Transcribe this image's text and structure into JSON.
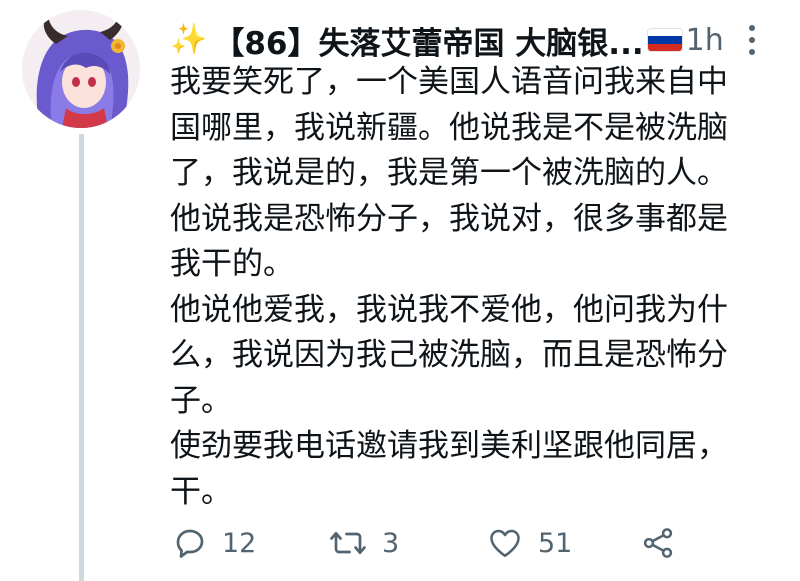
{
  "tweet": {
    "header": {
      "sparkle_icon": "sparkle-icon",
      "display_name": "【86】失落艾蕾帝国 大脑银...",
      "flag_icon": "russia-flag-icon",
      "flag_colors": [
        "#ffffff",
        "#0039a6",
        "#d52b1e"
      ],
      "time": "1h",
      "more_icon": "more-dots-icon"
    },
    "text_lines": [
      "我要笑死了，一个美国人语音问我来自中",
      "国哪里，我说新疆。他说我是不是被洗脑",
      "了，我说是的，我是第一个被洗脑的人。",
      "他说我是恐怖分子，我说对，很多事都是",
      "我干的。",
      "他说他爱我，我说我不爱他，他问我为什",
      "么，我说因为我己被洗脑，而且是恐怖分",
      "子。",
      "使劲要我电话邀请我到美利坚跟他同居，",
      "干。"
    ],
    "actions": {
      "reply": {
        "icon": "reply-icon",
        "count": "12"
      },
      "retweet": {
        "icon": "retweet-icon",
        "count": "3"
      },
      "like": {
        "icon": "heart-icon",
        "count": "51"
      },
      "share": {
        "icon": "share-icon"
      }
    },
    "colors": {
      "text": "#0f1419",
      "secondary": "#536471",
      "thread_line": "#cfd9de"
    }
  }
}
